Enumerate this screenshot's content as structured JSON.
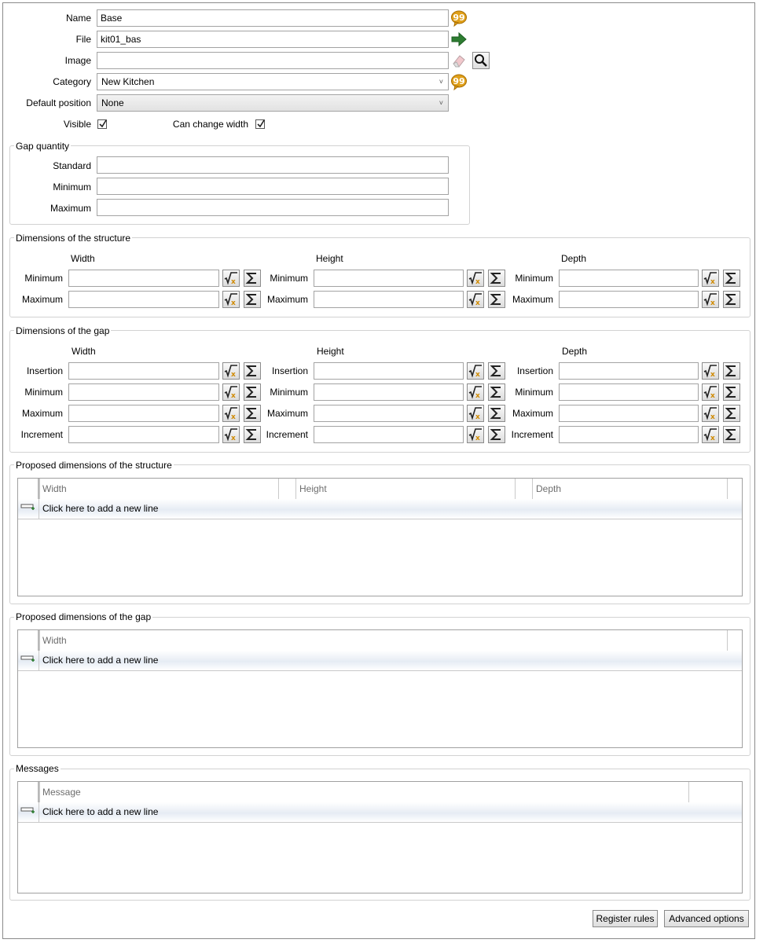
{
  "general": {
    "name_label": "Name",
    "name_value": "Base",
    "file_label": "File",
    "file_value": "kit01_bas",
    "image_label": "Image",
    "image_value": "",
    "category_label": "Category",
    "category_value": "New Kitchen",
    "default_position_label": "Default position",
    "default_position_value": "None",
    "visible_label": "Visible",
    "visible_checked": true,
    "can_change_width_label": "Can change width",
    "can_change_width_checked": true
  },
  "gap_quantity": {
    "title": "Gap quantity",
    "standard_label": "Standard",
    "minimum_label": "Minimum",
    "maximum_label": "Maximum"
  },
  "structure_dims": {
    "title": "Dimensions of the structure",
    "width_head": "Width",
    "height_head": "Height",
    "depth_head": "Depth",
    "minimum_label": "Minimum",
    "maximum_label": "Maximum"
  },
  "gap_dims": {
    "title": "Dimensions of the gap",
    "width_head": "Width",
    "height_head": "Height",
    "depth_head": "Depth",
    "insertion_label": "Insertion",
    "minimum_label": "Minimum",
    "maximum_label": "Maximum",
    "increment_label": "Increment"
  },
  "proposed_structure": {
    "title": "Proposed dimensions of the structure",
    "columns": [
      "Width",
      "Height",
      "Depth"
    ],
    "new_line": "Click here to add a new line"
  },
  "proposed_gap": {
    "title": "Proposed dimensions of the gap",
    "columns": [
      "Width"
    ],
    "new_line": "Click here to add a new line"
  },
  "messages": {
    "title": "Messages",
    "columns": [
      "Message"
    ],
    "new_line": "Click here to add a new line"
  },
  "footer": {
    "register_rules": "Register rules",
    "advanced_options": "Advanced options"
  },
  "icons": {
    "speech": "speech-bubble-icon",
    "arrow": "green-arrow-right-icon",
    "eraser": "eraser-icon",
    "search": "magnifier-icon",
    "formula": "formula-sqrt-x-icon",
    "sum": "sigma-sum-icon",
    "add_row": "add-row-icon",
    "check": "checkmark-icon"
  },
  "colors": {
    "bubble": "#e0a01a",
    "arrow": "#2e7d32",
    "fx_accent": "#d08a00"
  }
}
